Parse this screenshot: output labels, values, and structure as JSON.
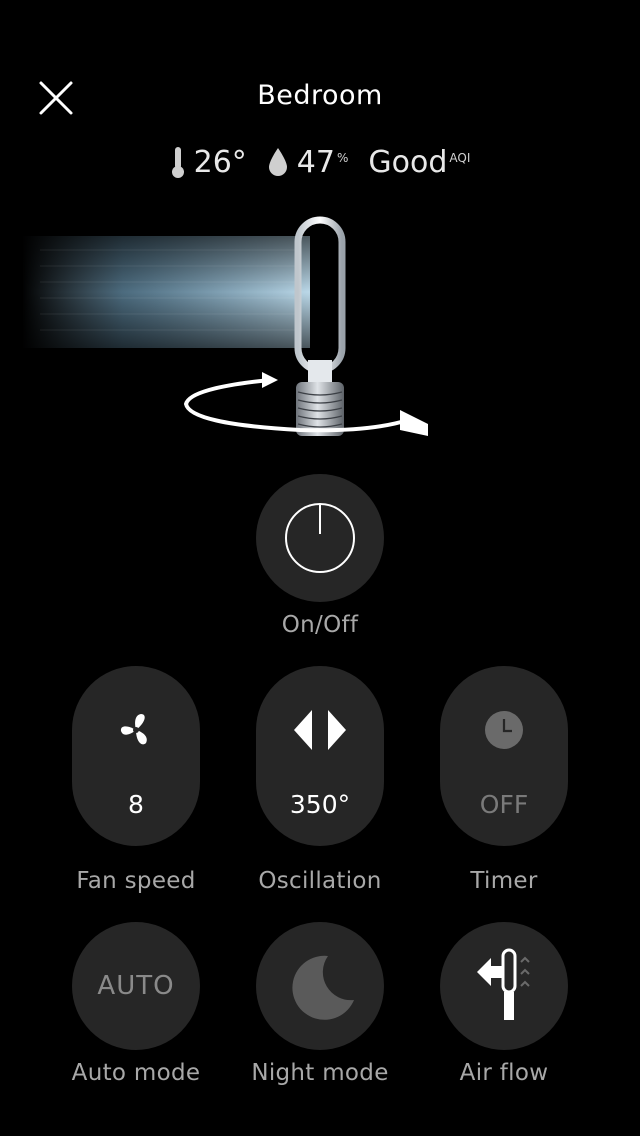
{
  "header": {
    "close_icon": "close-icon",
    "title": "Bedroom"
  },
  "environment": {
    "temperature": "26°",
    "humidity": "47",
    "humidity_unit": "%",
    "air_quality": "Good",
    "air_quality_unit": "AQI"
  },
  "controls": {
    "power": {
      "label": "On/Off",
      "icon": "power-icon"
    },
    "fan_speed": {
      "label": "Fan speed",
      "value": "8",
      "icon": "fan-icon"
    },
    "oscillation": {
      "label": "Oscillation",
      "value": "350°",
      "icon": "oscillation-arrows-icon"
    },
    "timer": {
      "label": "Timer",
      "value": "OFF",
      "icon": "clock-icon"
    },
    "auto_mode": {
      "label": "Auto mode",
      "value": "AUTO"
    },
    "night_mode": {
      "label": "Night mode",
      "icon": "moon-icon"
    },
    "air_flow": {
      "label": "Air flow",
      "icon": "air-flow-icon"
    }
  },
  "colors": {
    "background": "#000000",
    "button": "#262626",
    "label": "#a8a8a8",
    "airflow": "#a8d4ee"
  }
}
